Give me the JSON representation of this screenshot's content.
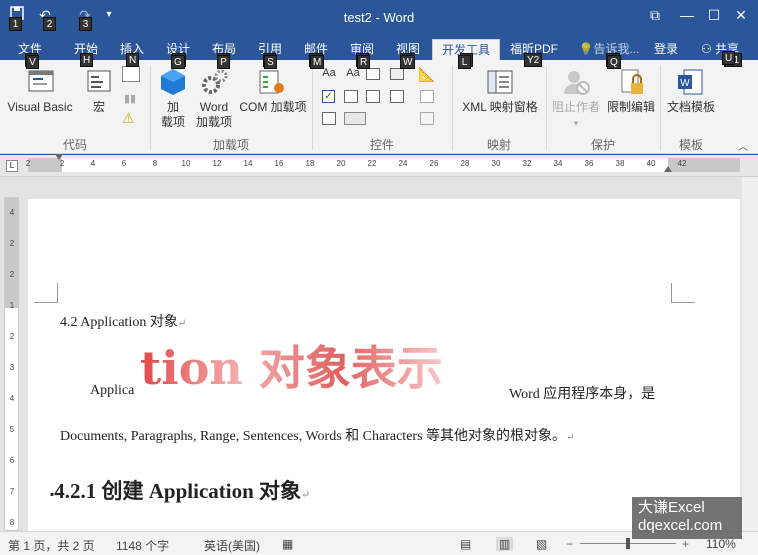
{
  "window": {
    "title": "test2 - Word"
  },
  "qat": {
    "save_icon": "save-icon",
    "undo_icon": "undo-icon",
    "redo_icon": "redo-icon",
    "key_save": "1",
    "key_undo": "2",
    "key_redo": "3"
  },
  "window_controls": {
    "ribbon_display": "⧉",
    "minimize": "—",
    "maximize": "☐",
    "close": "✕"
  },
  "tabs": [
    {
      "label": "文件",
      "key": "F"
    },
    {
      "label": "开始",
      "key": "H"
    },
    {
      "label": "插入",
      "key": "N"
    },
    {
      "label": "设计",
      "key": "G"
    },
    {
      "label": "布局",
      "key": "P"
    },
    {
      "label": "引用",
      "key": "S"
    },
    {
      "label": "邮件",
      "key": "M"
    },
    {
      "label": "审阅",
      "key": "R"
    },
    {
      "label": "视图",
      "key": "W"
    },
    {
      "label": "开发工具",
      "key": "L"
    },
    {
      "label": "福昕PDF",
      "key": "Y2"
    },
    {
      "label": "告诉我...",
      "key": "Q"
    },
    {
      "label": "登录",
      "key": ""
    },
    {
      "label": "共享",
      "key": "Y1"
    }
  ],
  "ribbon": {
    "visual_basic": "Visual Basic",
    "macros": "宏",
    "addins_1": "加",
    "addins_2": "载项",
    "word_addins_1": "Word",
    "word_addins_2": "加载项",
    "com_addins": "COM 加载项",
    "xml_mapping": "XML 映射窗格",
    "block_authors": "阻止作者",
    "restrict_editing": "限制编辑",
    "document_template": "文档模板",
    "groups": {
      "code": "代码",
      "addins": "加载项",
      "controls": "控件",
      "mapping": "映射",
      "protect": "保护",
      "templates": "模板"
    }
  },
  "ruler": {
    "ticks": [
      "2",
      "2",
      "4",
      "6",
      "8",
      "10",
      "12",
      "14",
      "16",
      "18",
      "20",
      "22",
      "24",
      "26",
      "28",
      "30",
      "32",
      "34",
      "36",
      "38",
      "40",
      "42"
    ],
    "vticks": [
      "4",
      "2",
      "2",
      "1",
      "2",
      "3",
      "4",
      "5",
      "6",
      "7",
      "8"
    ]
  },
  "document": {
    "heading_line": "4.2 Application  对象",
    "art_text": "tion 对象表示",
    "para1_start": "Applica",
    "para1_end": "Word 应用程序本身，是",
    "para2": "Documents, Paragraphs, Range, Sentences, Words 和 Characters 等其他对象的根对象。",
    "subheading": "4.2.1  创建 Application 对象"
  },
  "status": {
    "page": "第 1 页，共 2 页",
    "words": "1148 个字",
    "language": "英语(美国)",
    "zoom": "110%"
  },
  "watermark": {
    "line1": "大谦Excel",
    "line2": "dqexcel.com"
  },
  "colors": {
    "title_bar": "#2b579a",
    "art_text": "#e05050"
  }
}
